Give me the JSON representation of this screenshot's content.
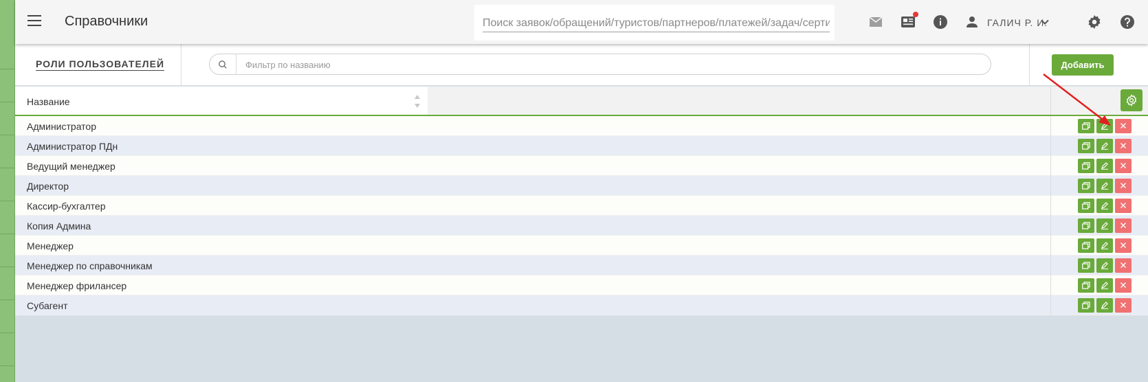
{
  "header": {
    "title": "Справочники",
    "search_placeholder": "Поиск заявок/обращений/туристов/партнеров/платежей/задач/сертификатов",
    "user_name": "ГАЛИЧ Р. И.",
    "news_badge_color": "#e53935"
  },
  "section": {
    "tab_label": "РОЛИ ПОЛЬЗОВАТЕЛЕЙ",
    "filter_placeholder": "Фильтр по названию",
    "add_label": "Добавить"
  },
  "table": {
    "column_name": "Название",
    "rows": [
      {
        "name": "Администратор"
      },
      {
        "name": "Администратор ПДн"
      },
      {
        "name": "Ведущий менеджер"
      },
      {
        "name": "Директор"
      },
      {
        "name": "Кассир-бухгалтер"
      },
      {
        "name": "Копия Админа"
      },
      {
        "name": "Менеджер"
      },
      {
        "name": "Менеджер по справочникам"
      },
      {
        "name": "Менеджер фрилансер"
      },
      {
        "name": "Субагент"
      }
    ],
    "row_actions": [
      "copy-icon",
      "edit-icon",
      "close-icon"
    ]
  },
  "colors": {
    "accent_green": "#6aaa3a",
    "delete_red": "#f07171",
    "annotation_arrow": "#e32020"
  }
}
